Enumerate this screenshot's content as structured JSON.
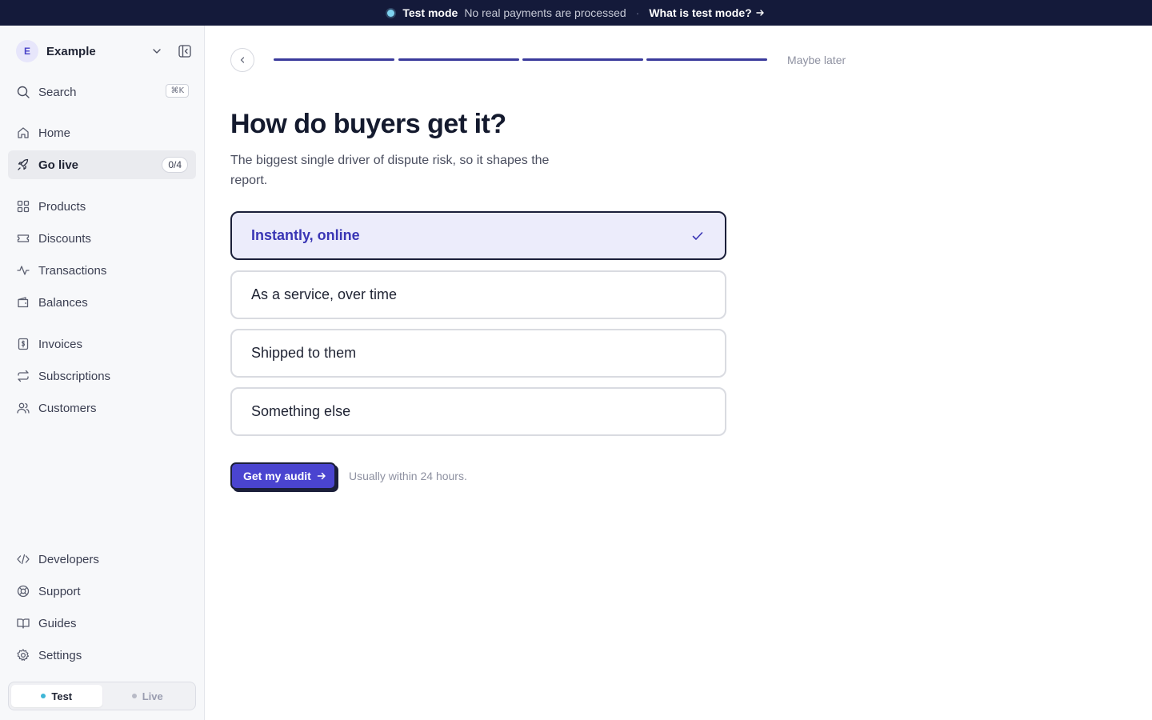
{
  "banner": {
    "mode": "Test mode",
    "note": "No real payments are processed",
    "separator": "·",
    "link": "What is test mode?"
  },
  "workspace": {
    "initial": "E",
    "name": "Example"
  },
  "search": {
    "label": "Search",
    "shortcut": "⌘K"
  },
  "nav": {
    "home": "Home",
    "go_live": "Go live",
    "go_live_count": "0/4",
    "products": "Products",
    "discounts": "Discounts",
    "transactions": "Transactions",
    "balances": "Balances",
    "invoices": "Invoices",
    "subscriptions": "Subscriptions",
    "customers": "Customers",
    "developers": "Developers",
    "support": "Support",
    "guides": "Guides",
    "settings": "Settings"
  },
  "environment": {
    "test": "Test",
    "live": "Live",
    "active": "Test"
  },
  "wizard": {
    "steps_total": 4,
    "steps_completed": 4,
    "skip_label": "Maybe later",
    "title": "How do buyers get it?",
    "subtitle": "The biggest single driver of dispute risk, so it shapes the report.",
    "options": [
      {
        "label": "Instantly, online",
        "selected": true
      },
      {
        "label": "As a service, over time",
        "selected": false
      },
      {
        "label": "Shipped to them",
        "selected": false
      },
      {
        "label": "Something else",
        "selected": false
      }
    ],
    "submit_label": "Get my audit",
    "submit_hint": "Usually within 24 hours."
  },
  "colors": {
    "accent": "#4a44d0",
    "banner_bg": "#141a3a",
    "selected_bg": "#ececfb",
    "test_dot": "#3fb6d6",
    "live_dot": "#b8bac6"
  }
}
